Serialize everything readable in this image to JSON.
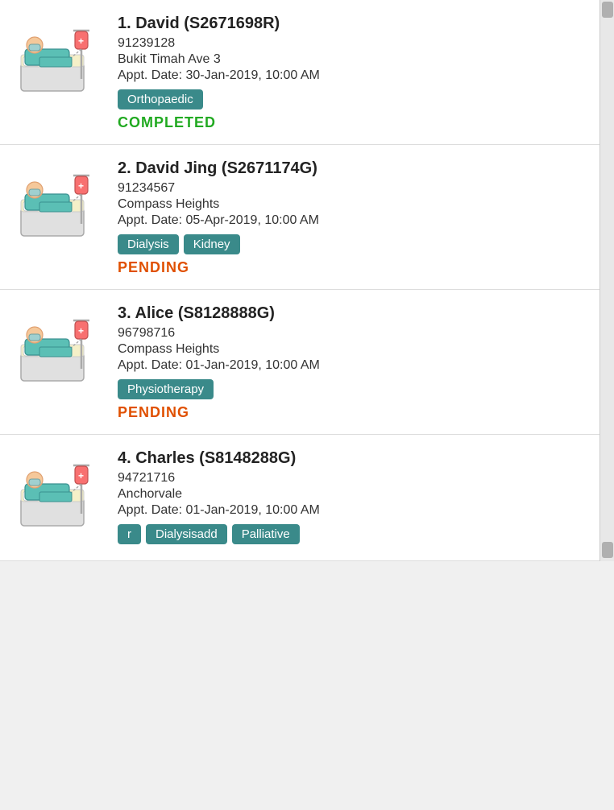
{
  "patients": [
    {
      "index": "1.",
      "name": "David (S2671698R)",
      "phone": "91239128",
      "address": "Bukit Timah Ave 3",
      "appt": "Appt. Date: 30-Jan-2019, 10:00 AM",
      "tags": [
        "Orthopaedic"
      ],
      "status": "COMPLETED",
      "status_type": "completed"
    },
    {
      "index": "2.",
      "name": "David Jing (S2671174G)",
      "phone": "91234567",
      "address": "Compass Heights",
      "appt": "Appt. Date: 05-Apr-2019, 10:00 AM",
      "tags": [
        "Dialysis",
        "Kidney"
      ],
      "status": "PENDING",
      "status_type": "pending"
    },
    {
      "index": "3.",
      "name": "Alice  (S8128888G)",
      "phone": "96798716",
      "address": "Compass Heights",
      "appt": "Appt. Date: 01-Jan-2019, 10:00 AM",
      "tags": [
        "Physiotherapy"
      ],
      "status": "PENDING",
      "status_type": "pending"
    },
    {
      "index": "4.",
      "name": "Charles (S8148288G)",
      "phone": "94721716",
      "address": "Anchorvale",
      "appt": "Appt. Date: 01-Jan-2019, 10:00 AM",
      "tags": [
        "r",
        "Dialysisadd",
        "Palliative"
      ],
      "status": "",
      "status_type": ""
    }
  ]
}
